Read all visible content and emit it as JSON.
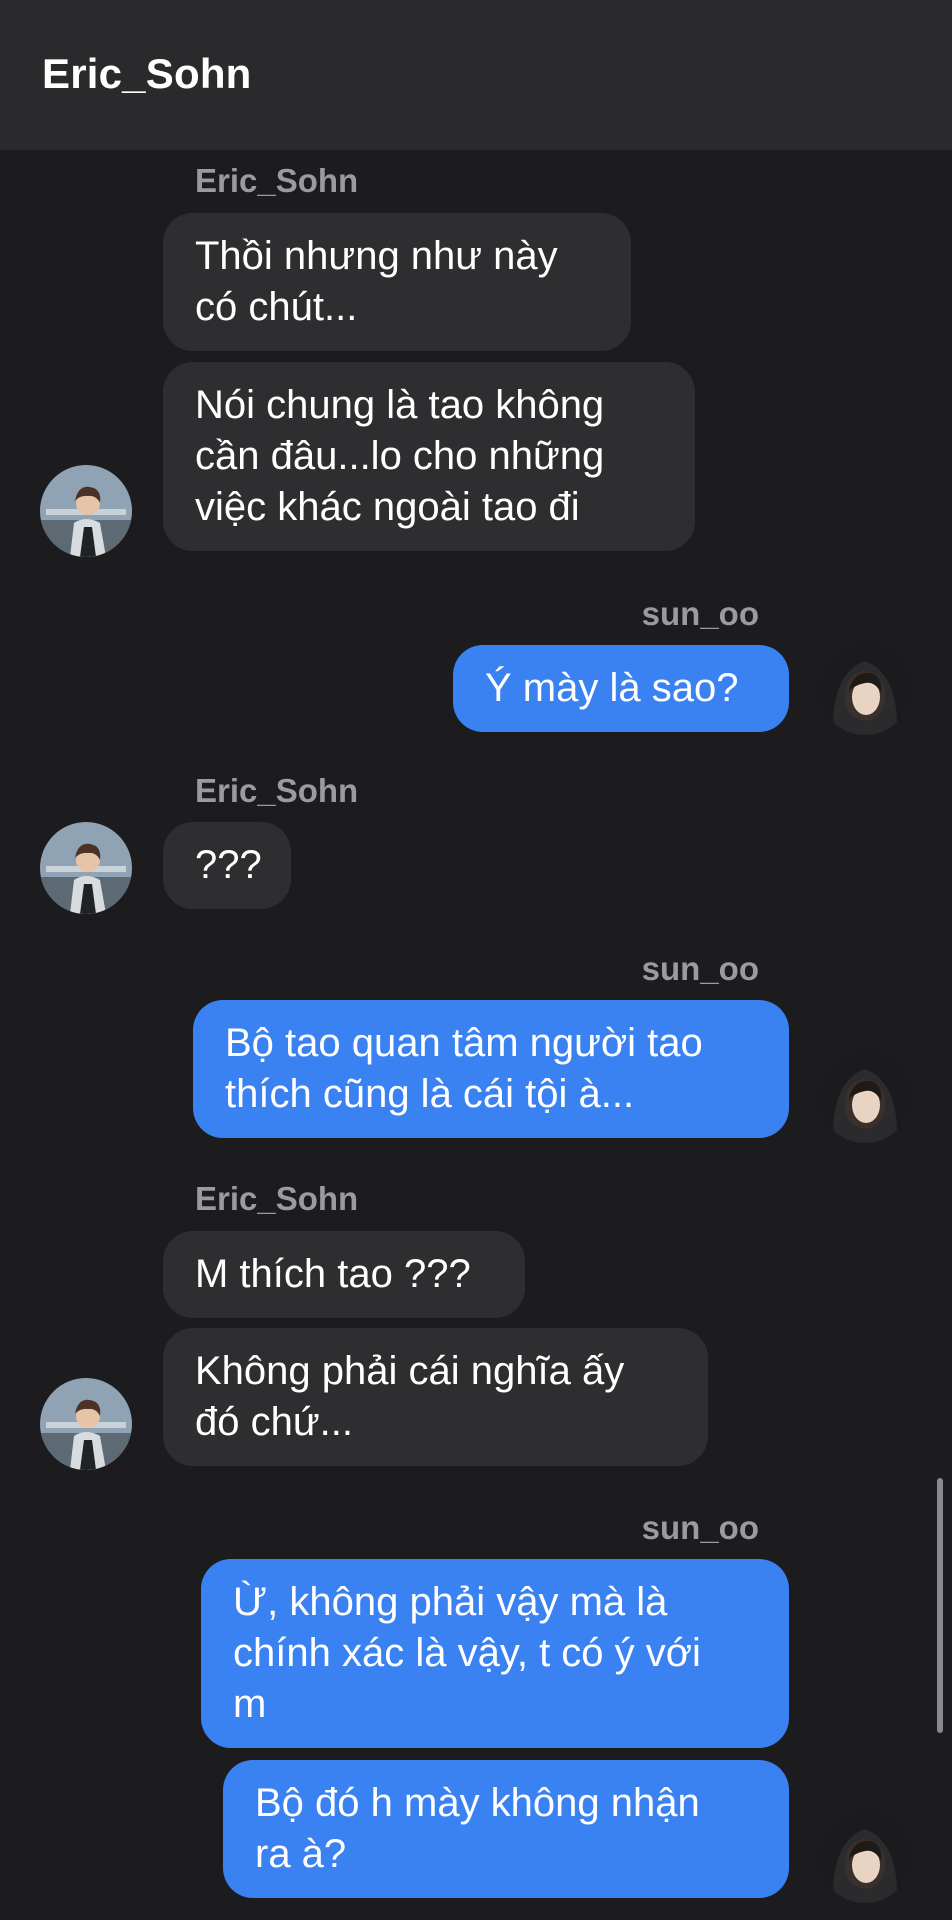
{
  "header": {
    "title": "Eric_Sohn"
  },
  "messages": {
    "m1": {
      "sender": "Eric_Sohn",
      "text": "Thồi nhưng như này\ncó chút..."
    },
    "m2": {
      "text": "Nói chung là tao không\ncần đâu...lo cho những\nviệc khác ngoài tao đi"
    },
    "m3": {
      "sender": "sun_oo",
      "text": "Ý mày là sao?"
    },
    "m4": {
      "sender": "Eric_Sohn",
      "text": "???"
    },
    "m5": {
      "sender": "sun_oo",
      "text": "Bộ tao quan tâm người tao\nthích cũng là cái tội à..."
    },
    "m6": {
      "sender": "Eric_Sohn",
      "text": "M thích tao ???"
    },
    "m7": {
      "text": "Không phải cái nghĩa ấy\nđó chứ..."
    },
    "m8": {
      "sender": "sun_oo",
      "text": "Ừ, không phải vậy mà là\nchính xác là vậy, t có ý với\nm"
    },
    "m9": {
      "text": "Bộ đó h mày không nhận\nra à?"
    }
  },
  "colors": {
    "background": "#1c1c1e",
    "header": "#2a2a2c",
    "incoming_bubble": "#2e2e30",
    "outgoing_bubble": "#3a82f2",
    "sender_name": "#9a9a9f"
  },
  "icons": {
    "eric_avatar": "eric-avatar-icon",
    "sun_avatar": "sun-avatar-icon"
  }
}
